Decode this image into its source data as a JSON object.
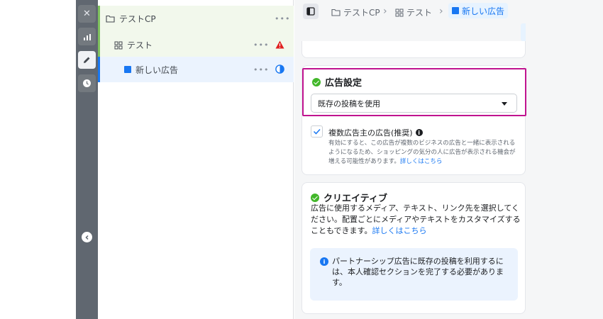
{
  "rail": {
    "close": "✕",
    "analytics": "analytics-icon",
    "edit": "edit-icon",
    "history": "history-icon",
    "collapse": "chevron-left-icon"
  },
  "tree": {
    "campaign": {
      "label": "テストCP",
      "more": "•••"
    },
    "adset": {
      "label": "テスト",
      "more": "•••"
    },
    "ad": {
      "label": "新しい広告",
      "more": "•••"
    }
  },
  "breadcrumb": {
    "campaign": "テストCP",
    "adset": "テスト",
    "ad": "新しい広告",
    "sep": "›"
  },
  "ad_settings": {
    "title": "広告設定",
    "select_value": "既存の投稿を使用",
    "multi_advertiser_label": "複数広告主の広告(推奨)",
    "multi_advertiser_desc": "有効にすると、この広告が複数のビジネスの広告と一緒に表示されるようになるため、ショッピングの気分の人に広告が表示される機会が増える可能性があります。",
    "learn_more": "詳しくはこちら"
  },
  "creative": {
    "title": "クリエイティブ",
    "desc": "広告に使用するメディア、テキスト、リンク先を選択してください。配置ごとにメディアやテキストをカスタマイズすることもできます。",
    "learn_more": "詳しくはこちら",
    "info": "パートナーシップ広告に既存の投稿を利用するには、本人確認セクションを完了する必要があります。"
  },
  "colors": {
    "highlight_border": "#c0138f",
    "accent": "#1877f2",
    "success": "#42b72a",
    "warning": "#e02020"
  }
}
